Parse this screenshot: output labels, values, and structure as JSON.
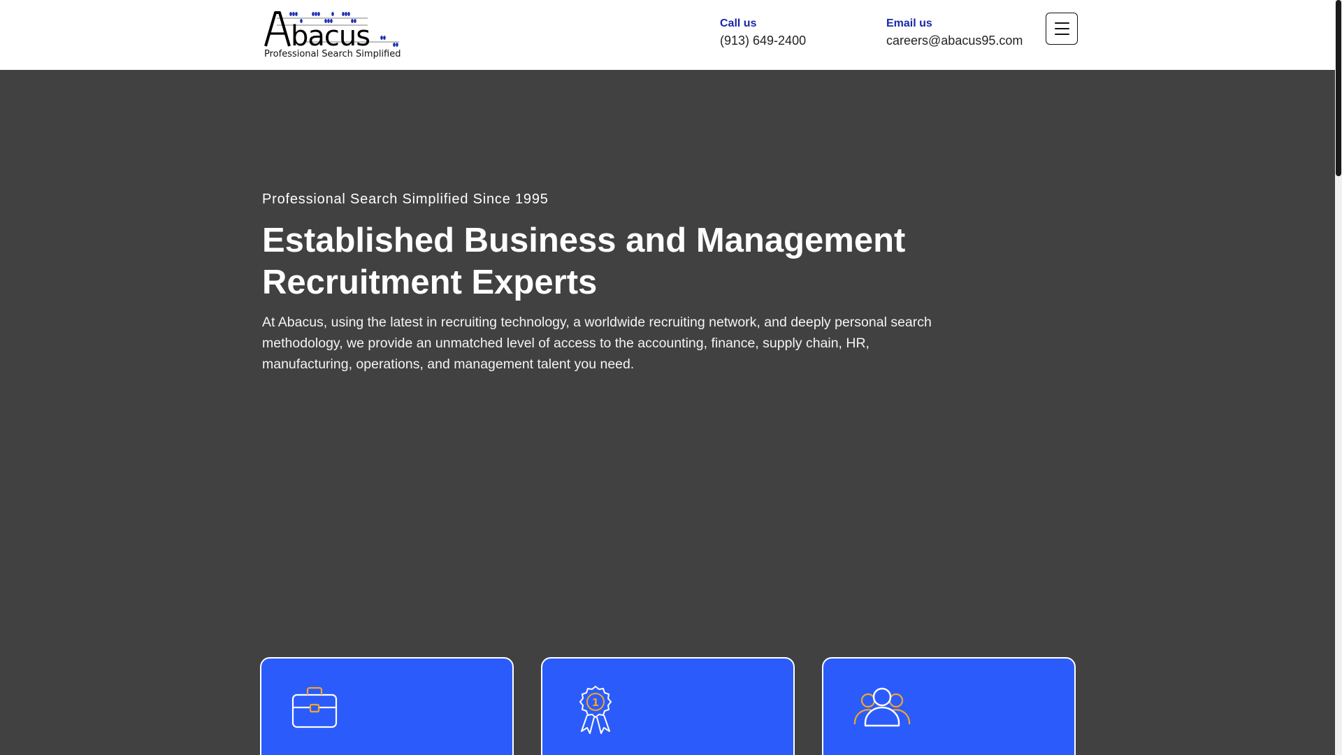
{
  "header": {
    "logo_text": "Abacus",
    "logo_tagline": "Professional Search Simplified",
    "call": {
      "label": "Call us",
      "value": "(913) 649-2400"
    },
    "email": {
      "label": "Email us",
      "value": "careers@abacus95.com"
    },
    "menu_icon": "hamburger-menu-icon"
  },
  "hero": {
    "eyebrow": "Professional Search Simplified Since 1995",
    "headline": "Established Business and Management Recruitment Experts",
    "description": "At Abacus, using the latest in recruiting technology, a worldwide recruiting network, and deeply personal search methodology, we provide an unmatched level of access to the accounting, finance, supply chain, HR, manufacturing, operations, and management talent you need."
  },
  "cards": [
    {
      "icon": "briefcase-icon"
    },
    {
      "icon": "award-ribbon-icon"
    },
    {
      "icon": "users-group-icon"
    }
  ],
  "colors": {
    "hero_background": "#414141",
    "accent_blue": "#2b5cfb",
    "contact_label": "#1a27a8",
    "icon_orange": "#f5a524"
  }
}
